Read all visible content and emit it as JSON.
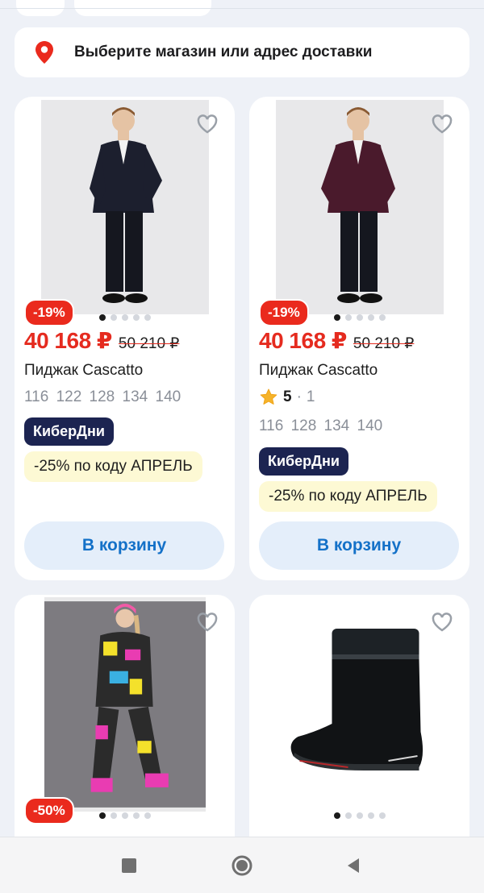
{
  "address": {
    "label": "Выберите магазин или адрес доставки",
    "icon": "location-pin-icon"
  },
  "colors": {
    "price": "#e52b1f",
    "badge_bg": "#1c2451",
    "cart_text": "#1471c8",
    "promo_bg": "#fdf9d4"
  },
  "products": [
    {
      "discount": "-19%",
      "price": "40 168 ₽",
      "old_price": "50 210 ₽",
      "name": "Пиджак Cascatto",
      "sizes": "116 122 128 134 140",
      "badge": "КиберДни",
      "promo": "-25% по коду АПРЕЛЬ",
      "cart": "В корзину"
    },
    {
      "discount": "-19%",
      "price": "40 168 ₽",
      "old_price": "50 210 ₽",
      "name": "Пиджак Cascatto",
      "rating": "5",
      "rating_sep": "·",
      "reviews": "1",
      "sizes": "116 128 134 140",
      "badge": "КиберДни",
      "promo": "-25% по коду АПРЕЛЬ",
      "cart": "В корзину"
    },
    {
      "discount": "-50%"
    },
    {}
  ],
  "navbar": {
    "items": [
      "recent-apps",
      "home",
      "back"
    ]
  }
}
